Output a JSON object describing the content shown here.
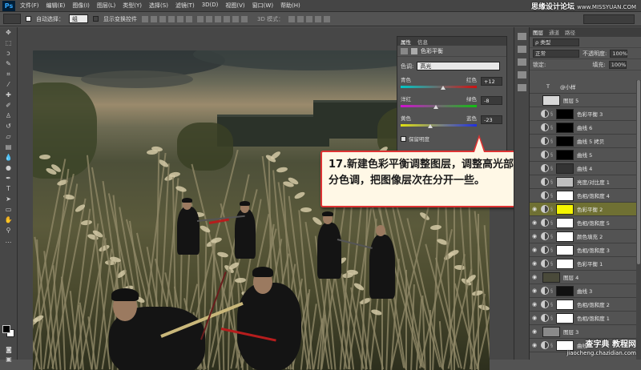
{
  "app": {
    "logo": "Ps"
  },
  "menu": [
    "文件(F)",
    "编辑(E)",
    "图像(I)",
    "图层(L)",
    "类型(Y)",
    "选择(S)",
    "滤镜(T)",
    "3D(D)",
    "视图(V)",
    "窗口(W)",
    "帮助(H)"
  ],
  "watermark_top": {
    "text": "思缘设计论坛",
    "url": "www.MISSYUAN.COM"
  },
  "options_bar": {
    "auto_select_label": "自动选择：",
    "auto_select_value": "组",
    "show_transform_label": "显示变换控件",
    "mode_3d": "3D 模式："
  },
  "properties": {
    "tabs": [
      "属性",
      "信息"
    ],
    "title": "色彩平衡",
    "tone_label": "色调:",
    "tone_value": "高光",
    "sliders": [
      {
        "left": "青色",
        "right": "红色",
        "value": "+12",
        "level": 12,
        "gradient": [
          "#00c8c8",
          "#d01010"
        ]
      },
      {
        "left": "洋红",
        "right": "绿色",
        "value": "-8",
        "level": -8,
        "gradient": [
          "#d010d0",
          "#10c010"
        ]
      },
      {
        "left": "黄色",
        "right": "蓝色",
        "value": "-23",
        "level": -23,
        "gradient": [
          "#e0e010",
          "#2030e0"
        ]
      }
    ],
    "preserve_luminosity": "保留明度"
  },
  "callout": {
    "text": "17.新建色彩平衡调整图层，调整高光部分色调，把图像层次在分开一些。"
  },
  "layers": {
    "tabs": [
      "图层",
      "通道",
      "路径"
    ],
    "filter_label": "ρ 类型",
    "blend_mode": "正常",
    "opacity_label": "不透明度:",
    "opacity_value": "100%",
    "lock_label": "锁定:",
    "fill_label": "填充:",
    "fill_value": "100%",
    "items": [
      {
        "name": "@小样",
        "kind": "text",
        "visible": false,
        "thumb": "#535353",
        "selected": false
      },
      {
        "name": "图层 5",
        "kind": "pixel",
        "visible": false,
        "thumb": "#d8d8d8",
        "selected": false
      },
      {
        "name": "色彩平衡 3",
        "kind": "adjust",
        "visible": false,
        "thumb": "#000000",
        "selected": false
      },
      {
        "name": "曲线 6",
        "kind": "adjust",
        "visible": false,
        "thumb": "#000000",
        "selected": false
      },
      {
        "name": "曲线 5 拷贝",
        "kind": "adjust",
        "visible": false,
        "thumb": "#000000",
        "selected": false
      },
      {
        "name": "曲线 5",
        "kind": "adjust",
        "visible": false,
        "thumb": "#000000",
        "selected": false
      },
      {
        "name": "曲线 4",
        "kind": "adjust",
        "visible": false,
        "thumb": "#333333",
        "selected": false
      },
      {
        "name": "亮度/对比度 1",
        "kind": "adjust",
        "visible": false,
        "thumb": "#bfbfbf",
        "selected": false
      },
      {
        "name": "色相/饱和度 4",
        "kind": "adjust",
        "visible": false,
        "thumb": "#ffffff",
        "selected": false
      },
      {
        "name": "色彩平衡 2",
        "kind": "adjust",
        "visible": true,
        "thumb": "#f5f500",
        "selected": true
      },
      {
        "name": "色相/饱和度 5",
        "kind": "adjust",
        "visible": true,
        "thumb": "#ffffff",
        "selected": false
      },
      {
        "name": "颜色填充 2",
        "kind": "fill",
        "visible": true,
        "thumb": "#ffffff",
        "selected": false
      },
      {
        "name": "色相/饱和度 3",
        "kind": "adjust",
        "visible": true,
        "thumb": "#ffffff",
        "selected": false
      },
      {
        "name": "色彩平衡 1",
        "kind": "adjust",
        "visible": true,
        "thumb": "#ffffff",
        "selected": false
      },
      {
        "name": "图层 4",
        "kind": "pixel",
        "visible": true,
        "thumb": "#4a4a3a",
        "selected": false
      },
      {
        "name": "曲线 3",
        "kind": "adjust",
        "visible": true,
        "thumb": "#111111",
        "selected": false
      },
      {
        "name": "色相/饱和度 2",
        "kind": "adjust",
        "visible": true,
        "thumb": "#ffffff",
        "selected": false
      },
      {
        "name": "色相/饱和度 1",
        "kind": "adjust",
        "visible": true,
        "thumb": "#ffffff",
        "selected": false
      },
      {
        "name": "图层 3",
        "kind": "pixel",
        "visible": true,
        "thumb": "#8a8a8a",
        "selected": false
      },
      {
        "name": "曲线 2",
        "kind": "adjust",
        "visible": true,
        "thumb": "#ffffff",
        "selected": false
      }
    ]
  },
  "watermark_bottom": {
    "line1": "查字典 教程网",
    "line2": "jiaocheng.chazidian.com"
  }
}
